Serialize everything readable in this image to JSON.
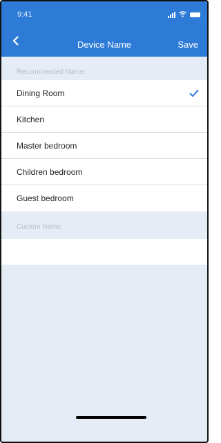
{
  "statusbar": {
    "time": "9:41",
    "icons": [
      "signal-icon",
      "wifi-icon",
      "battery-icon"
    ]
  },
  "navbar": {
    "back_icon": "chevron-left-icon",
    "title": "Device Name",
    "save_label": "Save"
  },
  "recommended": {
    "header": "Recommended Name:",
    "items": [
      {
        "label": "Dining Room",
        "selected": true
      },
      {
        "label": "Kitchen",
        "selected": false
      },
      {
        "label": "Master bedroom",
        "selected": false
      },
      {
        "label": "Children bedroom",
        "selected": false
      },
      {
        "label": "Guest bedroom",
        "selected": false
      }
    ]
  },
  "custom": {
    "header": "Custom Name:",
    "value": ""
  },
  "colors": {
    "accent": "#2d7bd6",
    "background": "#e6ecf5",
    "checkmark": "#2d7bd6"
  }
}
